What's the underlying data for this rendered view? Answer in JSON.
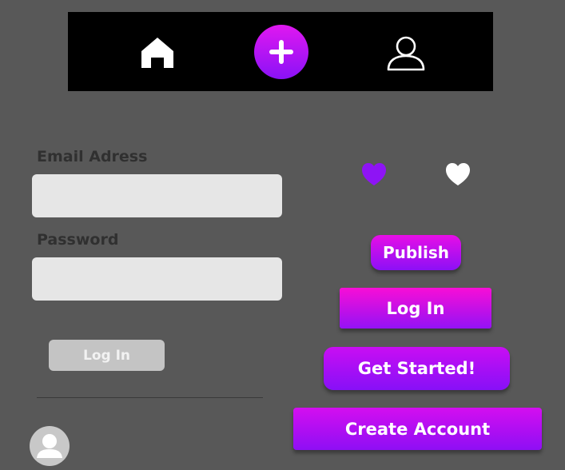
{
  "nav": {
    "home_icon": "home-icon",
    "add_icon": "plus-icon",
    "profile_icon": "user-outline-icon"
  },
  "form": {
    "email_label": "Email Adress",
    "email_value": "",
    "password_label": "Password",
    "password_value": "",
    "login_label": "Log In"
  },
  "icons": {
    "heart_filled_color": "#8e14f5",
    "heart_white_color": "#ffffff"
  },
  "buttons": {
    "publish": "Publish",
    "login": "Log In",
    "get_started": "Get Started!",
    "create_account": "Create Account"
  },
  "colors": {
    "background": "#585858",
    "navbar": "#000000",
    "accent_top": "#e70ee6",
    "accent_bottom": "#8c10f6",
    "field": "#e6e6e6",
    "label": "#303030"
  }
}
